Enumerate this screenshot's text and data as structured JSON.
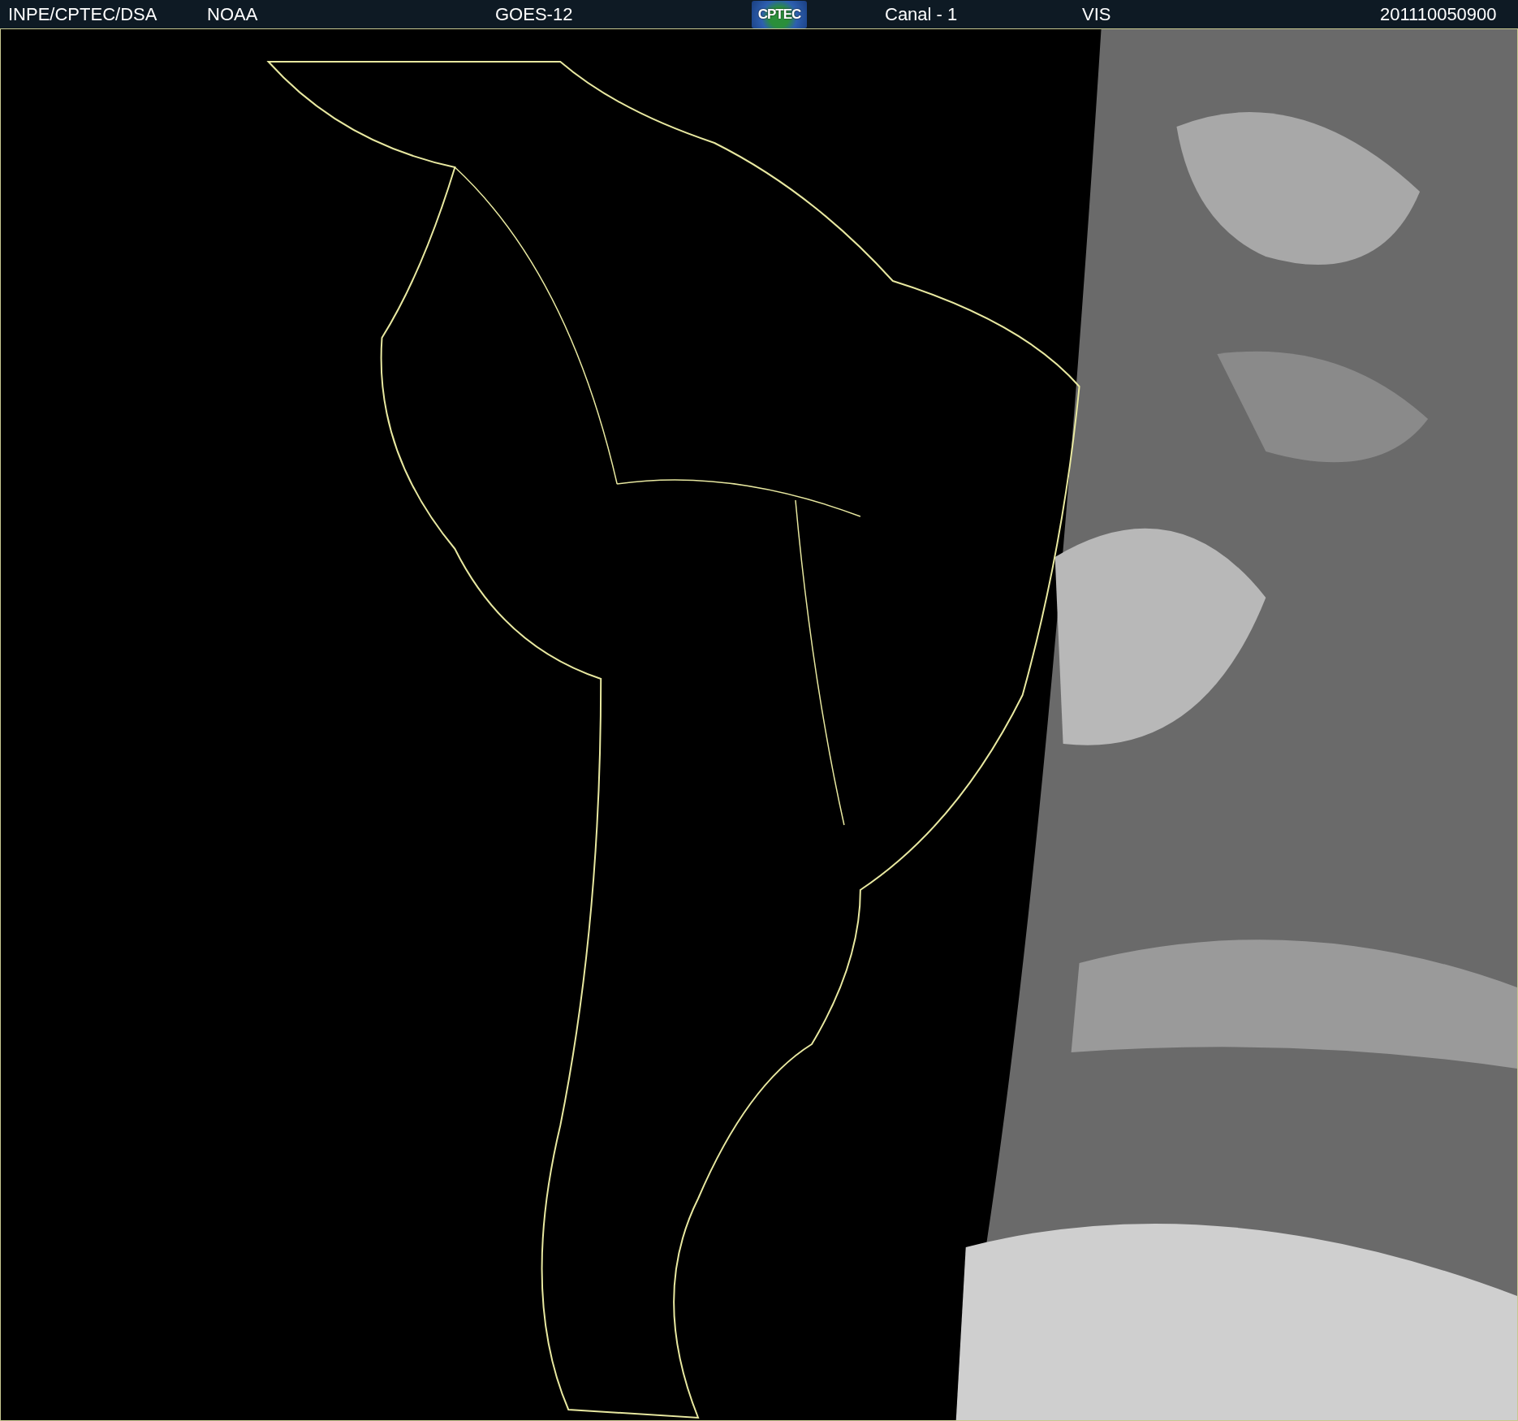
{
  "header": {
    "items": [
      {
        "kind": "text",
        "text": "INPE/CPTEC/DSA"
      },
      {
        "kind": "text",
        "text": "NOAA"
      },
      {
        "kind": "text",
        "text": "GOES-12"
      },
      {
        "kind": "logo",
        "text": "CPTEC"
      },
      {
        "kind": "text",
        "text": "Canal - 1"
      },
      {
        "kind": "text",
        "text": "VIS"
      },
      {
        "kind": "text",
        "text": "201110050900"
      }
    ]
  }
}
